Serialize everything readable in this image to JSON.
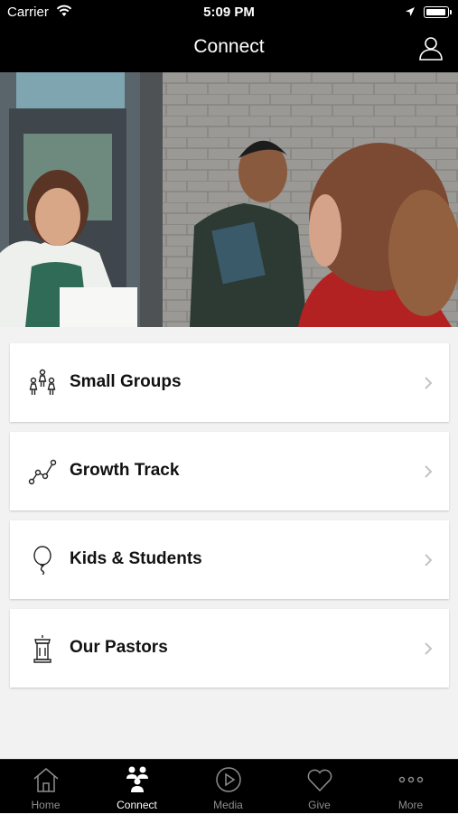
{
  "status_bar": {
    "carrier": "Carrier",
    "time": "5:09 PM"
  },
  "nav": {
    "title": "Connect"
  },
  "menu": [
    {
      "label": "Small Groups",
      "icon": "small-groups-icon"
    },
    {
      "label": "Growth Track",
      "icon": "growth-track-icon"
    },
    {
      "label": "Kids & Students",
      "icon": "balloon-icon"
    },
    {
      "label": "Our Pastors",
      "icon": "pulpit-icon"
    }
  ],
  "tabs": [
    {
      "label": "Home",
      "icon": "home-icon",
      "active": false
    },
    {
      "label": "Connect",
      "icon": "connect-icon",
      "active": true
    },
    {
      "label": "Media",
      "icon": "play-icon",
      "active": false
    },
    {
      "label": "Give",
      "icon": "heart-icon",
      "active": false
    },
    {
      "label": "More",
      "icon": "more-icon",
      "active": false
    }
  ],
  "colors": {
    "bar": "#000000",
    "background": "#f2f2f2",
    "card": "#ffffff",
    "tab_inactive": "#8e8e8e",
    "tab_active": "#ffffff"
  }
}
